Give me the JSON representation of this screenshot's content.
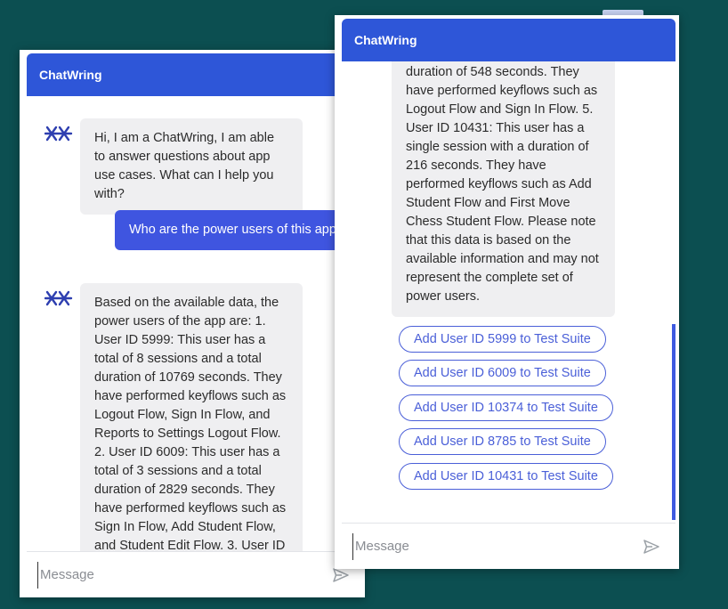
{
  "colors": {
    "background": "#0c4f51",
    "header": "#2e56d8",
    "user_bubble": "#3f55e0",
    "bot_bubble": "#efeff1",
    "suggestion_border": "#4a5fd8"
  },
  "left_window": {
    "title": "ChatWring",
    "avatar_icon": "chatwring-logo-icon",
    "bot_greeting": "Hi, I am a ChatWring, I am able to answer questions about app use cases. What can I help you with?",
    "user_message": "Who are the power users of this app?",
    "bot_answer": "Based on the available data, the power users of the app are: 1. User ID 5999: This user has a total of 8 sessions and a total duration of 10769 seconds. They have performed keyflows such as Logout Flow, Sign In Flow, and Reports to Settings Logout Flow. 2. User ID 6009: This user has a total of 3 sessions and a total duration of 2829 seconds. They have performed keyflows such as Sign In Flow, Add Student Flow, and Student Edit Flow. 3. User ID",
    "input_placeholder": "Message",
    "send_icon": "send-icon"
  },
  "right_window": {
    "title": "ChatWring",
    "bot_answer_tail": "duration of 548 seconds. They have performed keyflows such as Logout Flow and Sign In Flow. 5. User ID 10431: This user has a single session with a duration of 216 seconds. They have performed keyflows such as Add Student Flow and First Move Chess Student Flow. Please note that this data is based on the available information and may not represent the complete set of power users.",
    "suggestions": [
      "Add User ID 5999 to Test Suite",
      "Add User ID 6009 to Test Suite",
      "Add User ID 10374 to Test Suite",
      "Add User ID 8785 to Test Suite",
      "Add User ID 10431 to Test Suite"
    ],
    "input_placeholder": "Message",
    "send_icon": "send-icon"
  }
}
